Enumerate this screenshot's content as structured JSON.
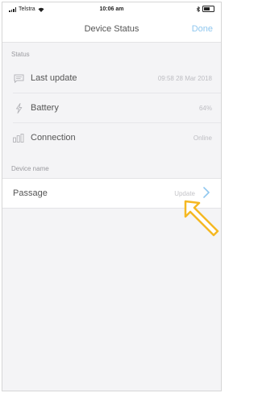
{
  "status_bar": {
    "carrier": "Telstra",
    "time": "10:06 am"
  },
  "nav": {
    "title": "Device Status",
    "done_label": "Done"
  },
  "status_section": {
    "header": "Status",
    "rows": [
      {
        "label": "Last update",
        "value": "09:58 28 Mar 2018",
        "icon": "message-icon"
      },
      {
        "label": "Battery",
        "value": "64%",
        "icon": "lightning-icon"
      },
      {
        "label": "Connection",
        "value": "Online",
        "icon": "signal-bars-icon"
      }
    ]
  },
  "device_name_section": {
    "header": "Device name",
    "name": "Passage",
    "update_label": "Update"
  },
  "colors": {
    "accent": "#8fc7ef",
    "annotation_arrow": "#f5b823"
  }
}
